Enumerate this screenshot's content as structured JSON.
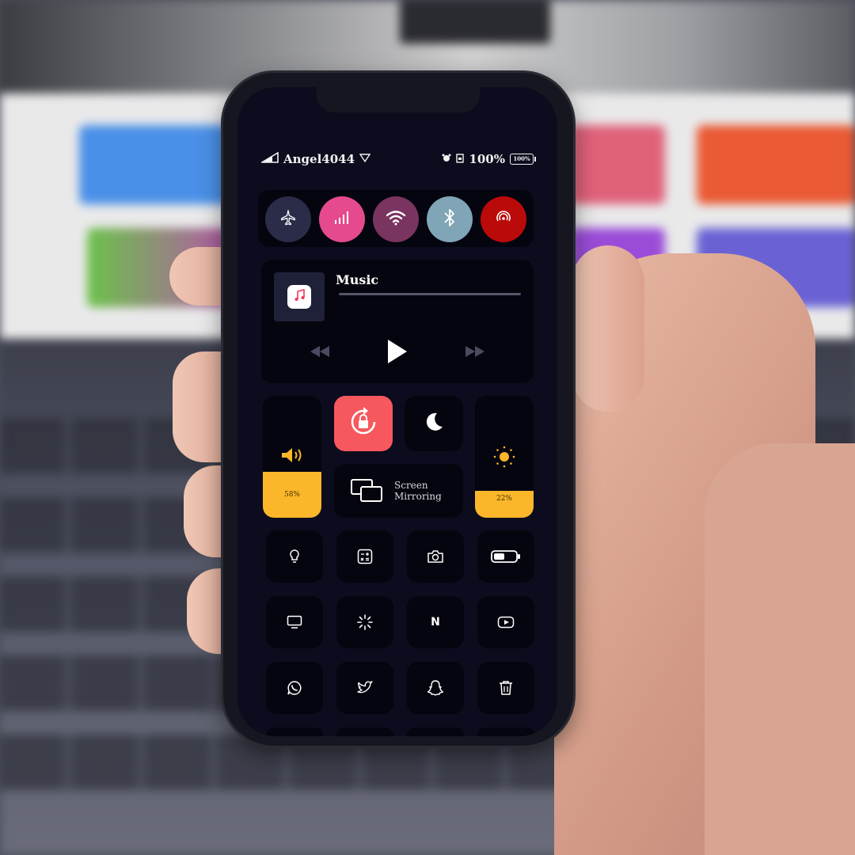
{
  "status_bar": {
    "carrier": "Angel4044",
    "battery_percent": "100%",
    "battery_label": "100%"
  },
  "connectivity": {
    "buttons": [
      {
        "name": "airplane",
        "color": "#2a2c48"
      },
      {
        "name": "cellular",
        "color": "#e54a8e"
      },
      {
        "name": "wifi",
        "color": "#7a3460"
      },
      {
        "name": "bluetooth",
        "color": "#7fa5b6"
      },
      {
        "name": "airdrop",
        "color": "#bb0a0a"
      }
    ]
  },
  "music": {
    "title": "Music",
    "icons": [
      "music-note-icon",
      "rewind-icon",
      "play-icon",
      "fast-forward-icon"
    ]
  },
  "controls": {
    "volume_label": "58%",
    "volume_level": 0.38,
    "brightness_label": "22%",
    "brightness_level": 0.22,
    "screen_mirroring_line1": "Screen",
    "screen_mirroring_line2": "Mirroring",
    "accent_yellow": "#fbb62a",
    "rotation_lock_color": "#f6585e"
  },
  "shortcut_grid": {
    "row1": [
      "flashlight-icon",
      "calculator-icon",
      "camera-icon",
      "battery-icon"
    ],
    "row2": [
      "tv-icon",
      "loading-icon",
      "netflix-icon",
      "youtube-icon"
    ],
    "row3": [
      "whatsapp-icon",
      "twitter-icon",
      "snapchat-icon",
      "trash-icon"
    ],
    "netflix_letter": "N"
  }
}
